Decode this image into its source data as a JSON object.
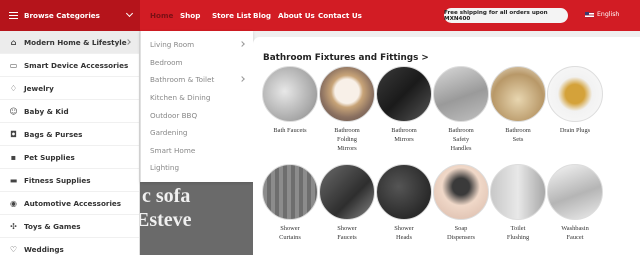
{
  "header": {
    "browse_label": "Browse Categories",
    "nav": [
      "Home",
      "Shop",
      "Store List",
      "Blog",
      "About Us",
      "Contact Us"
    ],
    "shipping": "Free shipping for all orders upon MXN400",
    "language": "English"
  },
  "sidebar": {
    "items": [
      {
        "label": "Modern Home & Lifestyle",
        "icon": "home-icon"
      },
      {
        "label": "Smart Device Accessories",
        "icon": "device-icon"
      },
      {
        "label": "Jewelry",
        "icon": "jewelry-icon"
      },
      {
        "label": "Baby & Kid",
        "icon": "baby-icon"
      },
      {
        "label": "Bags & Purses",
        "icon": "bag-icon"
      },
      {
        "label": "Pet Supplies",
        "icon": "pet-icon"
      },
      {
        "label": "Fitness Supplies",
        "icon": "fitness-icon"
      },
      {
        "label": "Automotive Accessories",
        "icon": "car-icon"
      },
      {
        "label": "Toys & Games",
        "icon": "toy-icon"
      },
      {
        "label": "Weddings",
        "icon": "wedding-icon"
      }
    ]
  },
  "submenu": {
    "items": [
      "Living Room",
      "Bedroom",
      "Bathroom & Toilet",
      "Kitchen & Dining",
      "Outdoor BBQ",
      "Gardening",
      "Smart Home",
      "Lighting"
    ]
  },
  "hero": {
    "line1": "c sofa",
    "line2": "Esteve"
  },
  "panel": {
    "title": "Bathroom Fixtures and Fittings >",
    "products": [
      "Bath Faucets",
      "Bathroom\nFolding\nMirrors",
      "Bathroom\nMirrors",
      "Bathroom\nSafety\nHandles",
      "Bathroom\nSets",
      "Drain Plugs",
      "Shower\nCurtains",
      "Shower\nFaucets",
      "Shower\nHeads",
      "Soap\nDispensers",
      "Toilet\nFlushing",
      "Washbasin\nFaucet"
    ]
  },
  "colors": {
    "brand_red": "#d21c24",
    "dark_red": "#b5141b"
  }
}
